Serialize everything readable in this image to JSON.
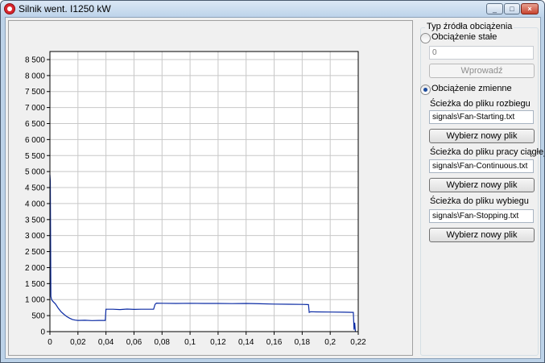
{
  "window": {
    "title": "Silnik went. I1250 kW",
    "minimize_glyph": "_",
    "maximize_glyph": "□",
    "close_glyph": "×"
  },
  "source_panel": {
    "title": "Typ źródła obciążenia",
    "constant_radio": {
      "label": "Obciążenie stałe",
      "checked": false
    },
    "constant_value": "0",
    "apply_button": "Wprowadź",
    "variable_radio": {
      "label": "Obciążenie zmienne",
      "checked": true
    },
    "startup_label": "Ścieżka do pliku rozbiegu",
    "startup_path": "signals\\Fan-Starting.txt",
    "continuous_label": "Ścieżka do pliku pracy ciągłej",
    "continuous_path": "signals\\Fan-Continuous.txt",
    "stopping_label": "Ścieżka do pliku wybiegu",
    "stopping_path": "signals\\Fan-Stopping.txt",
    "choose_file_button": "Wybierz nowy plik"
  },
  "chart_data": {
    "type": "line",
    "title": "",
    "xlabel": "",
    "ylabel": "",
    "xlim": [
      0,
      0.22
    ],
    "ylim": [
      0,
      8750
    ],
    "grid": true,
    "series_color": "#0b2ba4",
    "x_ticks": [
      "0",
      "0,02",
      "0,04",
      "0,06",
      "0,08",
      "0,1",
      "0,12",
      "0,14",
      "0,16",
      "0,18",
      "0,2",
      "0,22"
    ],
    "y_ticks": [
      "0",
      "500",
      "1 000",
      "1 500",
      "2 000",
      "2 500",
      "3 000",
      "3 500",
      "4 000",
      "4 500",
      "5 000",
      "5 500",
      "6 000",
      "6 500",
      "7 000",
      "7 500",
      "8 000",
      "8 500"
    ],
    "series": [
      {
        "x": [
          0,
          0.0003,
          0.0007,
          0.0012,
          0.002,
          0.004,
          0.006,
          0.008,
          0.01,
          0.012,
          0.014,
          0.016,
          0.018,
          0.02,
          0.025,
          0.03,
          0.035,
          0.0395,
          0.04,
          0.045,
          0.05,
          0.055,
          0.06,
          0.065,
          0.07,
          0.074,
          0.075,
          0.076,
          0.08,
          0.09,
          0.1,
          0.11,
          0.12,
          0.13,
          0.14,
          0.15,
          0.16,
          0.17,
          0.18,
          0.1845,
          0.185,
          0.186,
          0.19,
          0.2,
          0.21,
          0.2165,
          0.217,
          0.2175,
          0.218
        ],
        "y": [
          4900,
          4700,
          1100,
          1000,
          950,
          860,
          730,
          620,
          540,
          470,
          420,
          380,
          360,
          350,
          355,
          345,
          350,
          350,
          700,
          700,
          690,
          705,
          695,
          700,
          700,
          700,
          850,
          890,
          885,
          880,
          885,
          880,
          880,
          875,
          880,
          870,
          860,
          855,
          850,
          845,
          600,
          620,
          615,
          610,
          605,
          600,
          60,
          280,
          0
        ]
      }
    ]
  }
}
